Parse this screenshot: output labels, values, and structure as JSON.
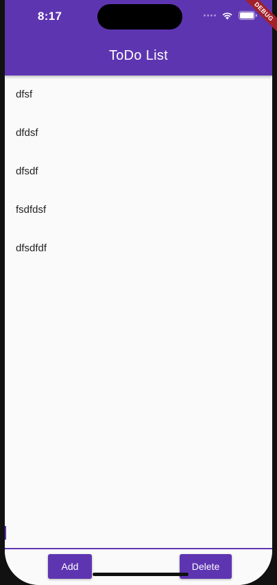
{
  "status_bar": {
    "time": "8:17",
    "icons": [
      "signal-dots-icon",
      "wifi-icon",
      "battery-icon"
    ]
  },
  "debug_banner": "DEBUG",
  "app_bar": {
    "title": "ToDo List",
    "color": "#5e35b1"
  },
  "todos": [
    {
      "label": "dfsf"
    },
    {
      "label": "dfdsf"
    },
    {
      "label": "dfsdf"
    },
    {
      "label": "fsdfdsf"
    },
    {
      "label": "dfsdfdf"
    }
  ],
  "actions": {
    "add_label": "Add",
    "delete_label": "Delete"
  }
}
